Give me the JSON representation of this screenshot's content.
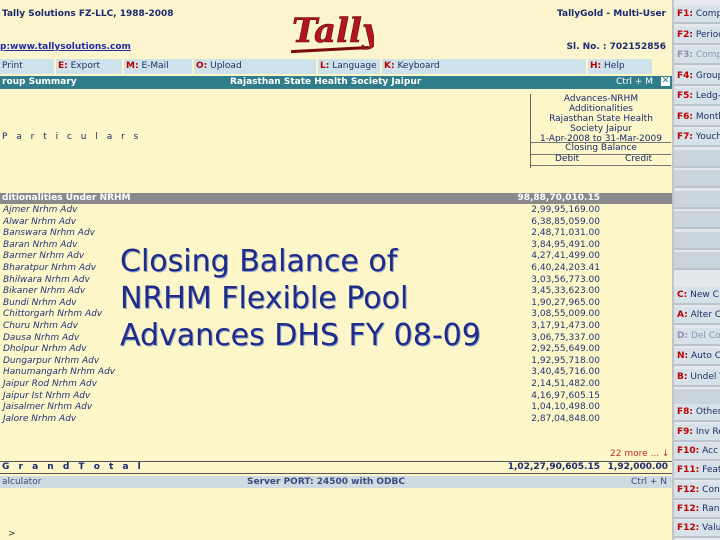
{
  "header": {
    "company_line": "Tally Solutions FZ-LLC, 1988-2008",
    "url": "p:www.tallysolutions.com",
    "product": "TallyGold - Multi-User",
    "serial": "Sl. No. : 702152856",
    "logo_text": "Tally"
  },
  "menu": [
    {
      "key": "",
      "label": "Print"
    },
    {
      "key": "E:",
      "label": "Export"
    },
    {
      "key": "M:",
      "label": "E-Mail"
    },
    {
      "key": "O:",
      "label": "Upload"
    },
    {
      "key": "L:",
      "label": "Language"
    },
    {
      "key": "K:",
      "label": "Keyboard"
    },
    {
      "key": "H:",
      "label": "Help"
    }
  ],
  "titlebar": {
    "left": "roup Summary",
    "center": "Rajasthan State Health Society Jaipur",
    "shortcut": "Ctrl + M",
    "close": "✕"
  },
  "column_header": {
    "line1": "Advances-NRHM Additionalities",
    "line2": "Rajasthan State Health",
    "line3": "Society Jaipur",
    "line4": "1-Apr-2008 to 31-Mar-2009",
    "closing": "Closing Balance",
    "debit": "Debit",
    "credit": "Credit"
  },
  "particulars_label": "P a r t i c u l a r s",
  "group": {
    "name": "ditionalities Under NRHM",
    "value": "98,88,70,010.15"
  },
  "rows": [
    {
      "name": "Ajmer Nrhm Adv",
      "value": "2,99,95,169.00"
    },
    {
      "name": "Alwar Nrhm Adv",
      "value": "6,38,85,059.00"
    },
    {
      "name": "Banswara Nrhm Adv",
      "value": "2,48,71,031.00"
    },
    {
      "name": "Baran Nrhm Adv",
      "value": "3,84,95,491.00"
    },
    {
      "name": "Barmer Nrhm Adv",
      "value": "4,27,41,499.00"
    },
    {
      "name": "Bharatpur Nrhm Adv",
      "value": "6,40,24,203.41"
    },
    {
      "name": "Bhilwara Nrhm Adv",
      "value": "3,03,56,773.00"
    },
    {
      "name": "Bikaner Nrhm Adv",
      "value": "3,45,33,623.00"
    },
    {
      "name": "Bundi Nrhm Adv",
      "value": "1,90,27,965.00"
    },
    {
      "name": "Chittorgarh Nrhm Adv",
      "value": "3,08,55,009.00"
    },
    {
      "name": "Churu Nrhm Adv",
      "value": "3,17,91,473.00"
    },
    {
      "name": "Dausa Nrhm Adv",
      "value": "3,06,75,337.00"
    },
    {
      "name": "Dholpur Nrhm Adv",
      "value": "2,92,55,649.00"
    },
    {
      "name": "Dungarpur Nrhm Adv",
      "value": "1,92,95,718.00"
    },
    {
      "name": "Hanumangarh Nrhm Adv",
      "value": "3,40,45,716.00"
    },
    {
      "name": "Jaipur Rod Nrhm Adv",
      "value": "2,14,51,482.00"
    },
    {
      "name": "Jaipur Ist Nrhm Adv",
      "value": "4,16,97,605.15"
    },
    {
      "name": "Jaisalmer Nrhm Adv",
      "value": "1,04,10,498.00"
    },
    {
      "name": "Jalore Nrhm Adv",
      "value": "2,87,04,848.00"
    }
  ],
  "more": "22 more ... ↓",
  "total": {
    "label": "G r a n d  T o t a l",
    "debit": "1,02,27,90,605.15",
    "credit": "1,92,000.00"
  },
  "calculator": {
    "left": "alculator",
    "center": "Server PORT: 24500 with ODBC",
    "right": "Ctrl + N"
  },
  "prompt": ">",
  "overlay": {
    "line1": "Closing Balance of",
    "line2": "NRHM Flexible Pool",
    "line3": "Advances DHS FY 08-09"
  },
  "sidebar_top": [
    {
      "key": "F1:",
      "label": "Compa"
    },
    {
      "key": "F2:",
      "label": "Period"
    },
    {
      "key": "F3:",
      "label": "Compa"
    },
    {
      "key": "F4:",
      "label": "Group"
    },
    {
      "key": "F5:",
      "label": "Ledg-w"
    },
    {
      "key": "F6:",
      "label": "Month"
    },
    {
      "key": "F7:",
      "label": "Youch"
    }
  ],
  "sidebar_mid": [
    {
      "key": "C:",
      "label": "New C"
    },
    {
      "key": "A:",
      "label": "Alter C"
    },
    {
      "key": "D:",
      "label": "Del Co"
    },
    {
      "key": "N:",
      "label": "Auto C"
    },
    {
      "key": "B:",
      "label": "Undel V"
    }
  ],
  "sidebar_bottom": [
    {
      "key": "F8:",
      "label": "Other"
    },
    {
      "key": "F9:",
      "label": "Inv Re"
    },
    {
      "key": "F10:",
      "label": "Acc"
    },
    {
      "key": "F11:",
      "label": "Feat"
    },
    {
      "key": "F12:",
      "label": "Conf"
    },
    {
      "key": "F12:",
      "label": "Rang"
    },
    {
      "key": "F12:",
      "label": "Valu"
    }
  ]
}
